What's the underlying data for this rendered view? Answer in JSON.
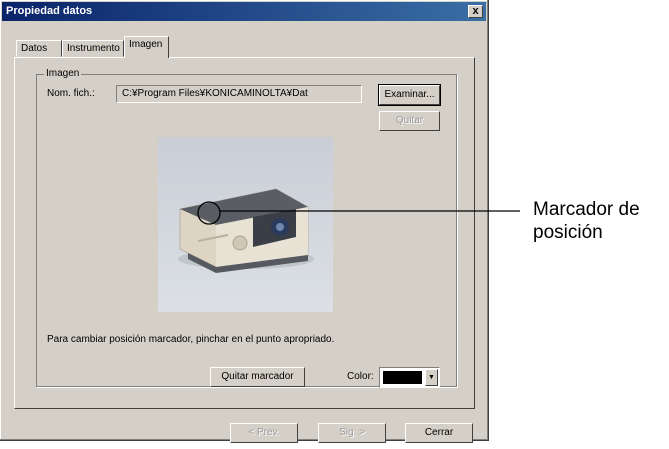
{
  "window": {
    "title": "Propiedad datos",
    "close_symbol": "x"
  },
  "tabs": [
    "Datos",
    "Instrumento",
    "Imagen"
  ],
  "image_group": {
    "label": "Imagen",
    "file_label": "Nom. fich.:",
    "file_value": "C:¥Program Files¥KONICAMINOLTA¥Dat",
    "browse_button": "Examinar...",
    "remove_button": "Quitar",
    "hint": "Para cambiar posición marcador, pinchar en el punto apropriado.",
    "remove_marker_button": "Quitar marcador",
    "color_label": "Color:",
    "marker_color": "#000000"
  },
  "footer": {
    "prev_button": "< Prev.",
    "next_button": "Sig. >",
    "close_button": "Cerrar"
  },
  "callout": {
    "line1": "Marcador de",
    "line2": "posición"
  }
}
